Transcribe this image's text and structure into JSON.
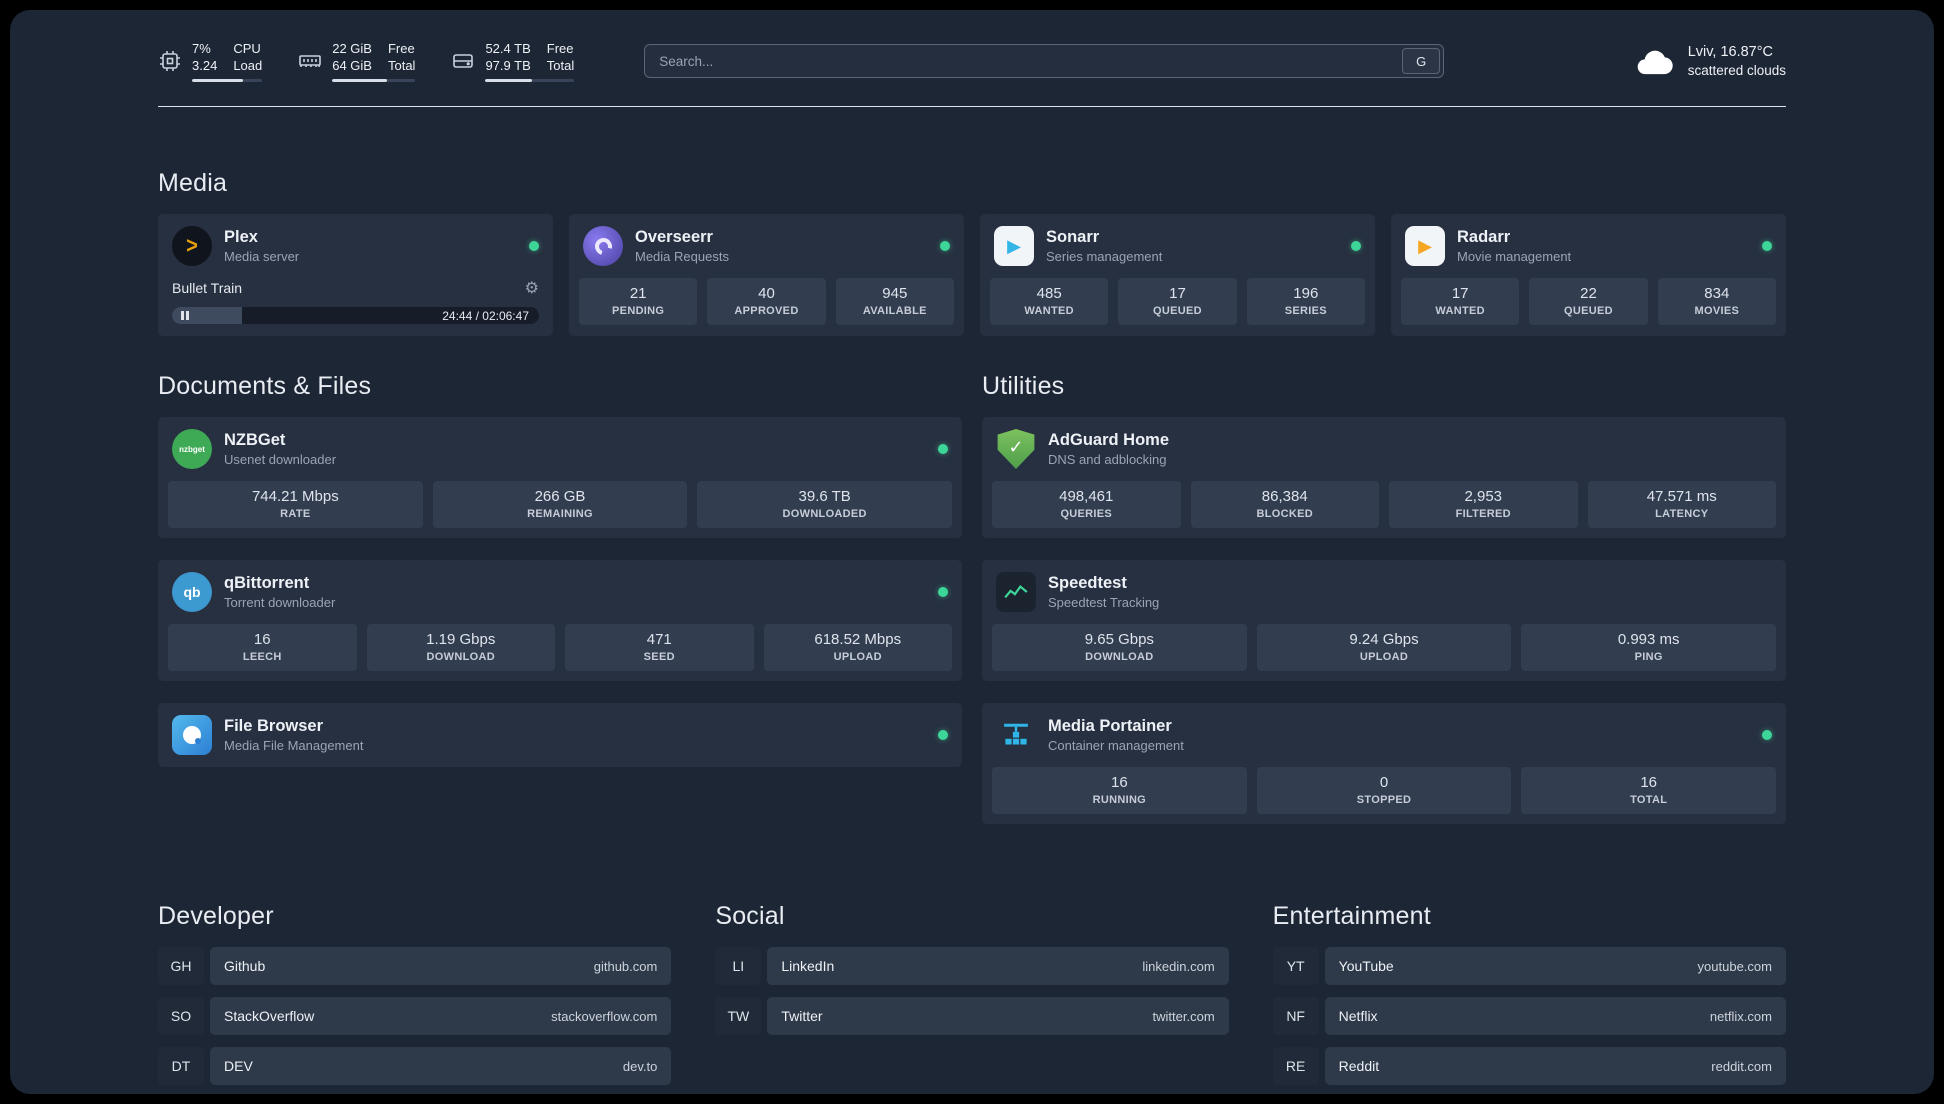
{
  "topbar": {
    "cpu": {
      "percent": "7%",
      "load": "3.24",
      "label_top": "CPU",
      "label_bottom": "Load",
      "bar": "72%"
    },
    "memory": {
      "free": "22 GiB",
      "total": "64 GiB",
      "label_top": "Free",
      "label_bottom": "Total",
      "bar": "66%"
    },
    "disk": {
      "free": "52.4 TB",
      "total": "97.9 TB",
      "label_top": "Free",
      "label_bottom": "Total",
      "bar": "53%"
    },
    "search": {
      "placeholder": "Search...",
      "engine_label": "G"
    },
    "weather": {
      "location": "Lviv, 16.87°C",
      "condition": "scattered clouds"
    }
  },
  "groups": {
    "media": {
      "title": "Media",
      "plex": {
        "name": "Plex",
        "subtitle": "Media server",
        "status": "online",
        "player": {
          "title": "Bullet Train",
          "time": "24:44 / 02:06:47",
          "progress": "19%"
        }
      },
      "overseerr": {
        "name": "Overseerr",
        "subtitle": "Media Requests",
        "status": "online",
        "stats": [
          {
            "value": "21",
            "label": "PENDING"
          },
          {
            "value": "40",
            "label": "APPROVED"
          },
          {
            "value": "945",
            "label": "AVAILABLE"
          }
        ]
      },
      "sonarr": {
        "name": "Sonarr",
        "subtitle": "Series management",
        "status": "online",
        "stats": [
          {
            "value": "485",
            "label": "WANTED"
          },
          {
            "value": "17",
            "label": "QUEUED"
          },
          {
            "value": "196",
            "label": "SERIES"
          }
        ]
      },
      "radarr": {
        "name": "Radarr",
        "subtitle": "Movie management",
        "status": "online",
        "stats": [
          {
            "value": "17",
            "label": "WANTED"
          },
          {
            "value": "22",
            "label": "QUEUED"
          },
          {
            "value": "834",
            "label": "MOVIES"
          }
        ]
      }
    },
    "documents": {
      "title": "Documents & Files",
      "nzbget": {
        "name": "NZBGet",
        "subtitle": "Usenet downloader",
        "status": "online",
        "stats": [
          {
            "value": "744.21 Mbps",
            "label": "RATE"
          },
          {
            "value": "266 GB",
            "label": "REMAINING"
          },
          {
            "value": "39.6 TB",
            "label": "DOWNLOADED"
          }
        ]
      },
      "qbittorrent": {
        "name": "qBittorrent",
        "subtitle": "Torrent downloader",
        "status": "online",
        "stats": [
          {
            "value": "16",
            "label": "LEECH"
          },
          {
            "value": "1.19 Gbps",
            "label": "DOWNLOAD"
          },
          {
            "value": "471",
            "label": "SEED"
          },
          {
            "value": "618.52 Mbps",
            "label": "UPLOAD"
          }
        ]
      },
      "filebrowser": {
        "name": "File Browser",
        "subtitle": "Media File Management",
        "status": "online"
      }
    },
    "utilities": {
      "title": "Utilities",
      "adguard": {
        "name": "AdGuard Home",
        "subtitle": "DNS and adblocking",
        "stats": [
          {
            "value": "498,461",
            "label": "QUERIES"
          },
          {
            "value": "86,384",
            "label": "BLOCKED"
          },
          {
            "value": "2,953",
            "label": "FILTERED"
          },
          {
            "value": "47.571 ms",
            "label": "LATENCY"
          }
        ]
      },
      "speedtest": {
        "name": "Speedtest",
        "subtitle": "Speedtest Tracking",
        "stats": [
          {
            "value": "9.65 Gbps",
            "label": "DOWNLOAD"
          },
          {
            "value": "9.24 Gbps",
            "label": "UPLOAD"
          },
          {
            "value": "0.993 ms",
            "label": "PING"
          }
        ]
      },
      "portainer": {
        "name": "Media Portainer",
        "subtitle": "Container management",
        "status": "online",
        "stats": [
          {
            "value": "16",
            "label": "RUNNING"
          },
          {
            "value": "0",
            "label": "STOPPED"
          },
          {
            "value": "16",
            "label": "TOTAL"
          }
        ]
      }
    }
  },
  "bookmarks": {
    "developer": {
      "title": "Developer",
      "items": [
        {
          "abbr": "GH",
          "name": "Github",
          "domain": "github.com"
        },
        {
          "abbr": "SO",
          "name": "StackOverflow",
          "domain": "stackoverflow.com"
        },
        {
          "abbr": "DT",
          "name": "DEV",
          "domain": "dev.to"
        }
      ]
    },
    "social": {
      "title": "Social",
      "items": [
        {
          "abbr": "LI",
          "name": "LinkedIn",
          "domain": "linkedin.com"
        },
        {
          "abbr": "TW",
          "name": "Twitter",
          "domain": "twitter.com"
        }
      ]
    },
    "entertainment": {
      "title": "Entertainment",
      "items": [
        {
          "abbr": "YT",
          "name": "YouTube",
          "domain": "youtube.com"
        },
        {
          "abbr": "NF",
          "name": "Netflix",
          "domain": "netflix.com"
        },
        {
          "abbr": "RE",
          "name": "Reddit",
          "domain": "reddit.com"
        }
      ]
    }
  },
  "icons": {
    "plex_glyph": ">",
    "play_glyph": "▶",
    "gear_glyph": "⚙",
    "nzbget_text": "nzbget",
    "qbittorrent_text": "qb",
    "adguard_check": "✓"
  },
  "colors": {
    "status_online": "#3ed598",
    "plex": "#e5a00d",
    "sonarr": "#33b5e5",
    "radarr": "#f5a623",
    "adguard": "#67b768",
    "qbittorrent": "#3d9ad1",
    "nzbget": "#3faa56",
    "portainer": "#2fb5e8"
  }
}
